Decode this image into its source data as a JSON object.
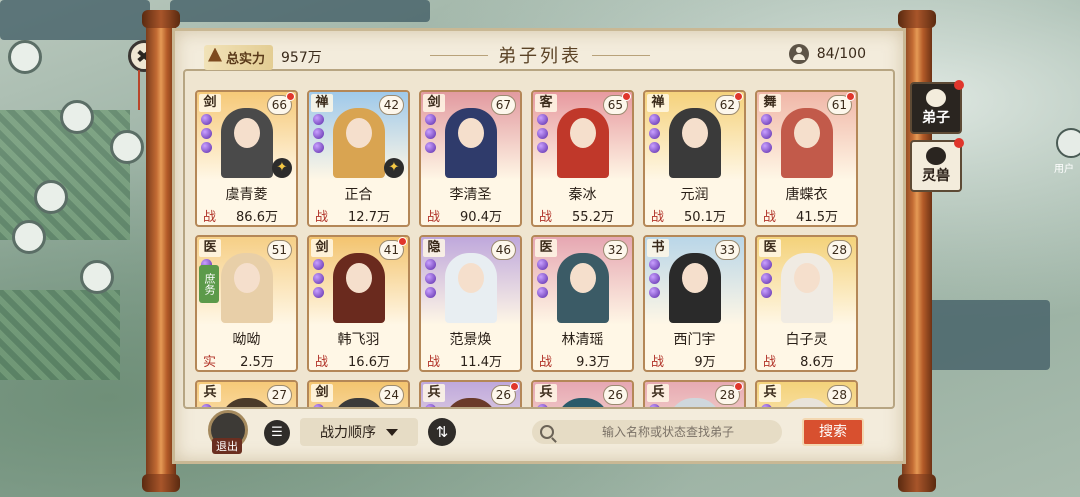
{
  "header": {
    "total_label": "总实力",
    "total_value": "957万",
    "title": "弟子列表",
    "count": "84/100"
  },
  "cards": [
    {
      "cls": "剑",
      "level": "66",
      "name": "虞青菱",
      "power_label": "战",
      "power": "86.6万",
      "dot": true,
      "star": true,
      "art": "#f6c978",
      "robe": "#4a4a4a"
    },
    {
      "cls": "禅",
      "level": "42",
      "name": "正合",
      "power_label": "战",
      "power": "12.7万",
      "dot": false,
      "star": true,
      "art": "#9fc9ea",
      "robe": "#d9a451"
    },
    {
      "cls": "剑",
      "level": "67",
      "name": "李清圣",
      "power_label": "战",
      "power": "90.4万",
      "dot": false,
      "star": false,
      "art": "#e29aa0",
      "robe": "#2f3b6b"
    },
    {
      "cls": "客",
      "level": "65",
      "name": "秦冰",
      "power_label": "战",
      "power": "55.2万",
      "dot": true,
      "star": false,
      "art": "#e79aa0",
      "robe": "#c0382a"
    },
    {
      "cls": "禅",
      "level": "62",
      "name": "元润",
      "power_label": "战",
      "power": "50.1万",
      "dot": true,
      "star": false,
      "art": "#f5d27c",
      "robe": "#3a3a3a"
    },
    {
      "cls": "舞",
      "level": "61",
      "name": "唐蝶衣",
      "power_label": "战",
      "power": "41.5万",
      "dot": true,
      "star": false,
      "art": "#f0b7a8",
      "robe": "#c25a4a"
    },
    {
      "cls": "医",
      "level": "51",
      "name": "呦呦",
      "power_label": "实",
      "power": "2.5万",
      "dot": false,
      "star": false,
      "art": "#f6cf86",
      "robe": "#e8cfa8",
      "tag": "庶务"
    },
    {
      "cls": "剑",
      "level": "41",
      "name": "韩飞羽",
      "power_label": "战",
      "power": "16.6万",
      "dot": true,
      "star": false,
      "art": "#f3c46f",
      "robe": "#6a2a1e"
    },
    {
      "cls": "隐",
      "level": "46",
      "name": "范景焕",
      "power_label": "战",
      "power": "11.4万",
      "dot": false,
      "star": false,
      "art": "#bfa8dc",
      "robe": "#e8eef2"
    },
    {
      "cls": "医",
      "level": "32",
      "name": "林清瑶",
      "power_label": "战",
      "power": "9.3万",
      "dot": false,
      "star": false,
      "art": "#e6a7b2",
      "robe": "#3b5b66"
    },
    {
      "cls": "书",
      "level": "33",
      "name": "西门宇",
      "power_label": "战",
      "power": "9万",
      "dot": false,
      "star": false,
      "art": "#b9d6e8",
      "robe": "#2a2a2a"
    },
    {
      "cls": "医",
      "level": "28",
      "name": "白子灵",
      "power_label": "战",
      "power": "8.6万",
      "dot": false,
      "star": false,
      "art": "#f4d27a",
      "robe": "#f0ebe3"
    },
    {
      "cls": "兵",
      "level": "27",
      "name": "",
      "power_label": "",
      "power": "",
      "dot": false,
      "star": false,
      "art": "#f6c978",
      "robe": "#4a3a2a"
    },
    {
      "cls": "剑",
      "level": "24",
      "name": "",
      "power_label": "",
      "power": "",
      "dot": false,
      "star": false,
      "art": "#f3c46f",
      "robe": "#3b3b3b"
    },
    {
      "cls": "兵",
      "level": "26",
      "name": "",
      "power_label": "",
      "power": "",
      "dot": true,
      "star": false,
      "art": "#bfa8dc",
      "robe": "#6a3a2a"
    },
    {
      "cls": "兵",
      "level": "26",
      "name": "",
      "power_label": "",
      "power": "",
      "dot": false,
      "star": false,
      "art": "#e6a7b2",
      "robe": "#2a5a6a"
    },
    {
      "cls": "兵",
      "level": "28",
      "name": "",
      "power_label": "",
      "power": "",
      "dot": true,
      "star": false,
      "art": "#e7aab2",
      "robe": "#cfd7dc"
    },
    {
      "cls": "兵",
      "level": "28",
      "name": "",
      "power_label": "",
      "power": "",
      "dot": false,
      "star": false,
      "art": "#f4d27a",
      "robe": "#e8e3da"
    }
  ],
  "toolbar": {
    "exit_label": "退出",
    "sort_label": "战力顺序",
    "search_placeholder": "输入名称或状态查找弟子",
    "search_button": "搜索"
  },
  "side_tabs": [
    {
      "label": "弟子",
      "active": true,
      "dot": true
    },
    {
      "label": "灵兽",
      "active": false,
      "dot": true
    }
  ],
  "right_user_label": "用户"
}
